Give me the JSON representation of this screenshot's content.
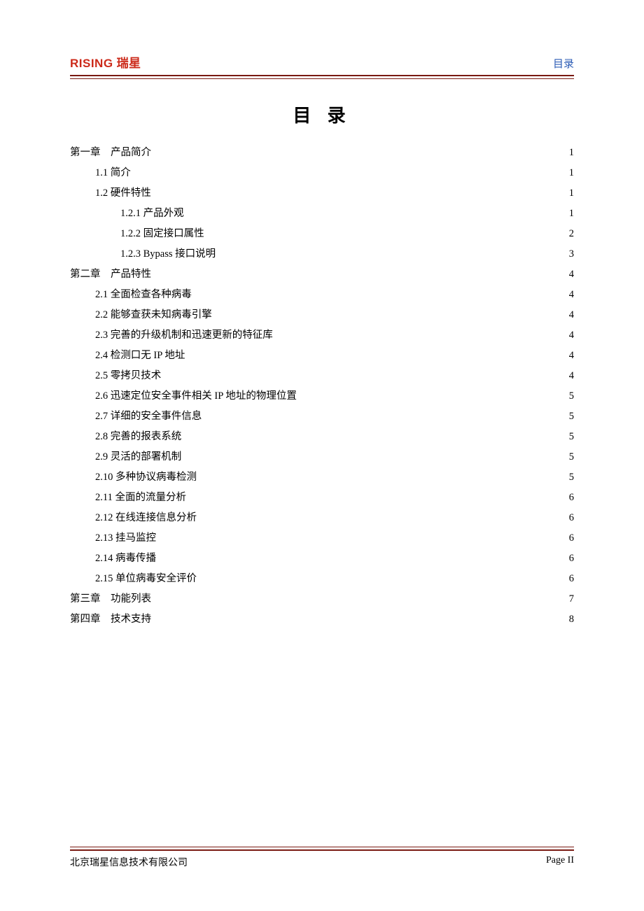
{
  "header": {
    "logo_en": "RISING",
    "logo_cn": "瑞星",
    "right": "目录"
  },
  "title": "目 录",
  "toc": [
    {
      "indent": 0,
      "label": "第一章　产品简介",
      "page": "1"
    },
    {
      "indent": 1,
      "label": "1.1 简介",
      "page": "1"
    },
    {
      "indent": 1,
      "label": "1.2 硬件特性",
      "page": "1"
    },
    {
      "indent": 2,
      "label": "1.2.1 产品外观",
      "page": "1"
    },
    {
      "indent": 2,
      "label": "1.2.2 固定接口属性",
      "page": "2"
    },
    {
      "indent": 2,
      "label": "1.2.3 Bypass 接口说明",
      "page": "3"
    },
    {
      "indent": 0,
      "label": "第二章　产品特性",
      "page": "4"
    },
    {
      "indent": 1,
      "label": "2.1 全面检查各种病毒",
      "page": "4"
    },
    {
      "indent": 1,
      "label": "2.2 能够查获未知病毒引擎",
      "page": "4"
    },
    {
      "indent": 1,
      "label": "2.3 完善的升级机制和迅速更新的特征库",
      "page": "4"
    },
    {
      "indent": 1,
      "label": "2.4 检测口无 IP 地址",
      "page": "4"
    },
    {
      "indent": 1,
      "label": "2.5 零拷贝技术",
      "page": "4"
    },
    {
      "indent": 1,
      "label": "2.6 迅速定位安全事件相关 IP 地址的物理位置",
      "page": "5"
    },
    {
      "indent": 1,
      "label": "2.7 详细的安全事件信息",
      "page": "5"
    },
    {
      "indent": 1,
      "label": "2.8 完善的报表系统",
      "page": "5"
    },
    {
      "indent": 1,
      "label": "2.9 灵活的部署机制",
      "page": "5"
    },
    {
      "indent": 1,
      "label": "2.10 多种协议病毒检测",
      "page": "5"
    },
    {
      "indent": 1,
      "label": "2.11 全面的流量分析",
      "page": "6"
    },
    {
      "indent": 1,
      "label": "2.12 在线连接信息分析",
      "page": "6"
    },
    {
      "indent": 1,
      "label": "2.13 挂马监控",
      "page": "6"
    },
    {
      "indent": 1,
      "label": "2.14 病毒传播",
      "page": "6"
    },
    {
      "indent": 1,
      "label": "2.15 单位病毒安全评价",
      "page": "6"
    },
    {
      "indent": 0,
      "label": "第三章　功能列表",
      "page": "7"
    },
    {
      "indent": 0,
      "label": "第四章　技术支持",
      "page": "8"
    }
  ],
  "footer": {
    "left": "北京瑞星信息技术有限公司",
    "right": "Page II"
  }
}
